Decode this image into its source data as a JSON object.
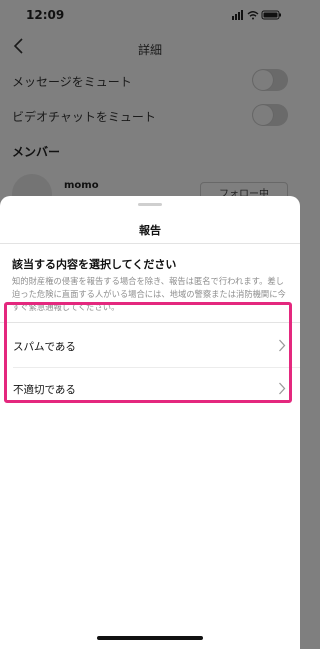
{
  "status_bar": {
    "time": "12:09"
  },
  "nav": {
    "title": "詳細"
  },
  "settings": [
    {
      "label": "メッセージをミュート"
    },
    {
      "label": "ビデオチャットをミュート"
    }
  ],
  "members": {
    "heading": "メンバー",
    "items": [
      {
        "name": "momo",
        "action": "フォロー中"
      }
    ]
  },
  "sheet": {
    "title": "報告",
    "prompt_heading": "該当する内容を選択してください",
    "prompt_description": "知的財産権の侵害を報告する場合を除き、報告は匿名で行われます。差し迫った危険に直面する人がいる場合には、地域の警察または消防機関に今すぐ緊急通報してください。",
    "options": [
      {
        "label": "スパムである"
      },
      {
        "label": "不適切である"
      }
    ]
  },
  "colors": {
    "highlight": "#e4287e",
    "overlay_background": "#7f7f7f",
    "sheet_background": "#ffffff"
  }
}
